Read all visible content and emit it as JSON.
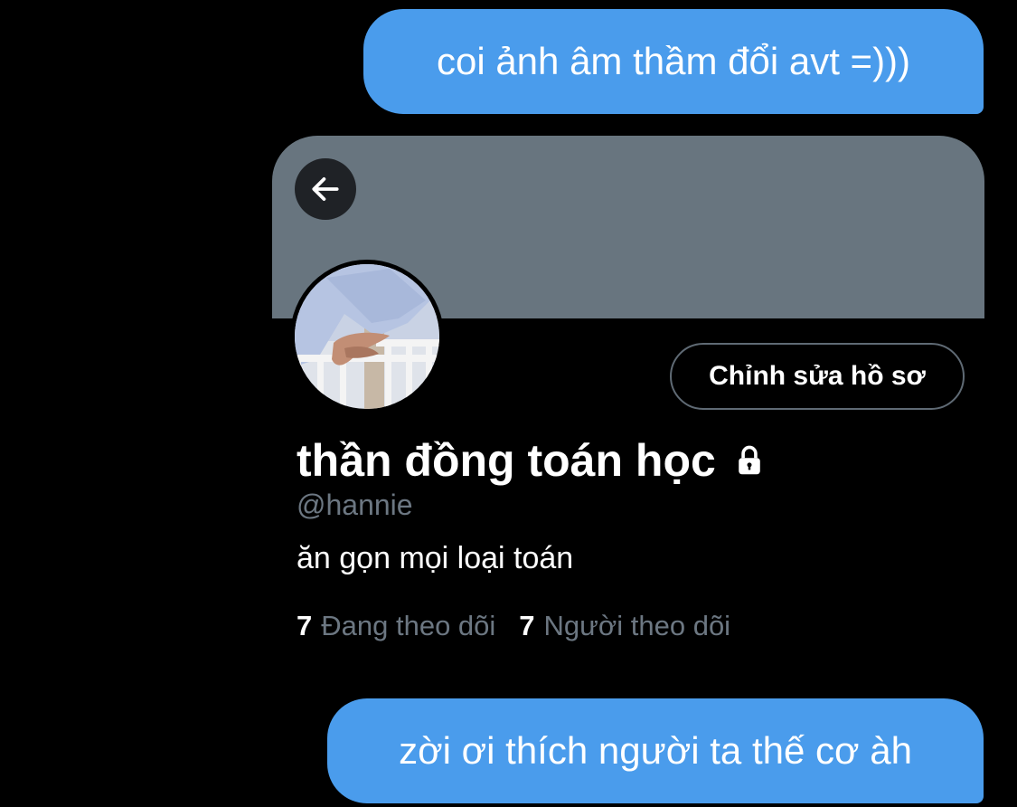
{
  "messages": [
    {
      "text": "coi ảnh âm thầm đổi avt =)))",
      "sender": "self"
    },
    {
      "text": "zời ơi thích người ta thế cơ àh",
      "sender": "self"
    }
  ],
  "profile": {
    "back_icon": "arrow-left-icon",
    "edit_button_label": "Chỉnh sửa hồ sơ",
    "display_name": "thần đồng toán học",
    "lock_icon": "lock-icon",
    "handle": "@hannie",
    "bio": "ăn gọn mọi loại toán",
    "following_count": "7",
    "following_label": "Đang theo dõi",
    "followers_count": "7",
    "followers_label": "Người theo dõi"
  },
  "colors": {
    "bubble": "#4a9cec",
    "banner": "#68757f",
    "background": "#000000",
    "muted_text": "#6c7782"
  }
}
